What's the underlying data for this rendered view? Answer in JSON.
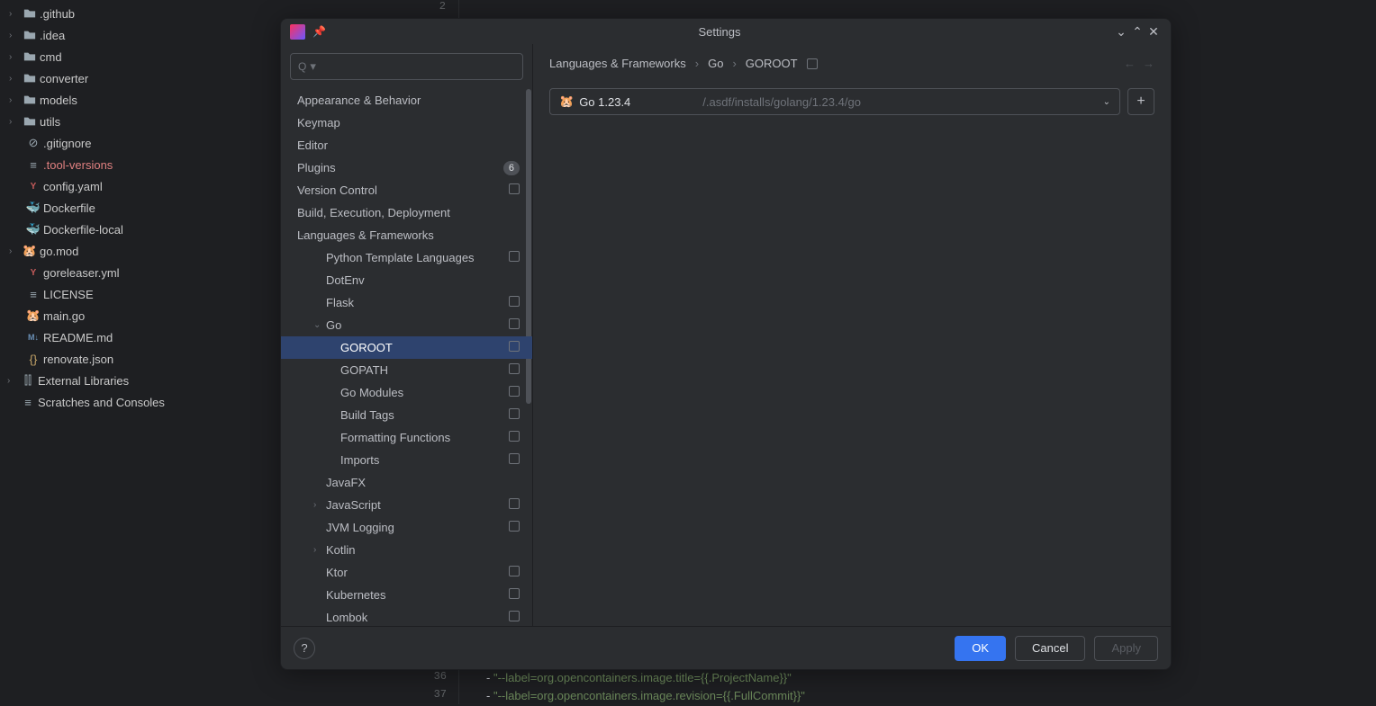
{
  "projectTree": [
    {
      "label": ".github",
      "icon": "folder",
      "chev": "›",
      "indent": 1
    },
    {
      "label": ".idea",
      "icon": "folder",
      "chev": "›",
      "indent": 1
    },
    {
      "label": "cmd",
      "icon": "folder",
      "chev": "›",
      "indent": 1
    },
    {
      "label": "converter",
      "icon": "folder",
      "chev": "›",
      "indent": 1
    },
    {
      "label": "models",
      "icon": "folder",
      "chev": "›",
      "indent": 1
    },
    {
      "label": "utils",
      "icon": "folder",
      "chev": "›",
      "indent": 1
    },
    {
      "label": ".gitignore",
      "icon": "gitignore",
      "indent": 2
    },
    {
      "label": ".tool-versions",
      "icon": "text",
      "indent": 2,
      "highlight": true
    },
    {
      "label": "config.yaml",
      "icon": "yaml",
      "indent": 2
    },
    {
      "label": "Dockerfile",
      "icon": "docker",
      "indent": 2
    },
    {
      "label": "Dockerfile-local",
      "icon": "docker",
      "indent": 2
    },
    {
      "label": "go.mod",
      "icon": "gomod",
      "chev": "›",
      "indent": 1
    },
    {
      "label": "goreleaser.yml",
      "icon": "yaml",
      "indent": 2
    },
    {
      "label": "LICENSE",
      "icon": "text",
      "indent": 2
    },
    {
      "label": "main.go",
      "icon": "go",
      "indent": 2
    },
    {
      "label": "README.md",
      "icon": "md",
      "indent": 2
    },
    {
      "label": "renovate.json",
      "icon": "json",
      "indent": 2
    }
  ],
  "externalLibraries": "External Libraries",
  "scratches": "Scratches and Consoles",
  "gutterTop": "2",
  "bottomLines": [
    {
      "num": "36",
      "dash": "-",
      "text": "\"--label=org.opencontainers.image.title={{.ProjectName}}\""
    },
    {
      "num": "37",
      "dash": "-",
      "text": "\"--label=org.opencontainers.image.revision={{.FullCommit}}\""
    }
  ],
  "modal": {
    "title": "Settings",
    "searchPlaceholder": "",
    "tree": [
      {
        "label": "Appearance & Behavior",
        "chev": "›"
      },
      {
        "label": "Keymap"
      },
      {
        "label": "Editor",
        "chev": "›"
      },
      {
        "label": "Plugins",
        "badgeNum": "6"
      },
      {
        "label": "Version Control",
        "chev": "›",
        "proj": true
      },
      {
        "label": "Build, Execution, Deployment",
        "chev": "›"
      },
      {
        "label": "Languages & Frameworks",
        "chev": "⌄"
      },
      {
        "label": "Python Template Languages",
        "sub": true,
        "proj": true
      },
      {
        "label": "DotEnv",
        "sub": true
      },
      {
        "label": "Flask",
        "sub": true,
        "proj": true
      },
      {
        "label": "Go",
        "sub": true,
        "chev": "⌄",
        "proj": true
      },
      {
        "label": "GOROOT",
        "sub2": true,
        "selected": true,
        "proj": true
      },
      {
        "label": "GOPATH",
        "sub2": true,
        "proj": true
      },
      {
        "label": "Go Modules",
        "sub2": true,
        "proj": true
      },
      {
        "label": "Build Tags",
        "sub2": true,
        "proj": true
      },
      {
        "label": "Formatting Functions",
        "sub2": true,
        "proj": true
      },
      {
        "label": "Imports",
        "sub2": true,
        "proj": true
      },
      {
        "label": "JavaFX",
        "sub": true
      },
      {
        "label": "JavaScript",
        "sub": true,
        "chev": "›",
        "proj": true
      },
      {
        "label": "JVM Logging",
        "sub": true,
        "proj": true
      },
      {
        "label": "Kotlin",
        "sub": true,
        "chev": "›"
      },
      {
        "label": "Ktor",
        "sub": true,
        "proj": true
      },
      {
        "label": "Kubernetes",
        "sub": true,
        "proj": true
      },
      {
        "label": "Lombok",
        "sub": true,
        "proj": true
      }
    ],
    "breadcrumb": [
      "Languages & Frameworks",
      "Go",
      "GOROOT"
    ],
    "sdk": {
      "name": "Go 1.23.4",
      "path": "/.asdf/installs/golang/1.23.4/go"
    },
    "buttons": {
      "ok": "OK",
      "cancel": "Cancel",
      "apply": "Apply"
    }
  }
}
